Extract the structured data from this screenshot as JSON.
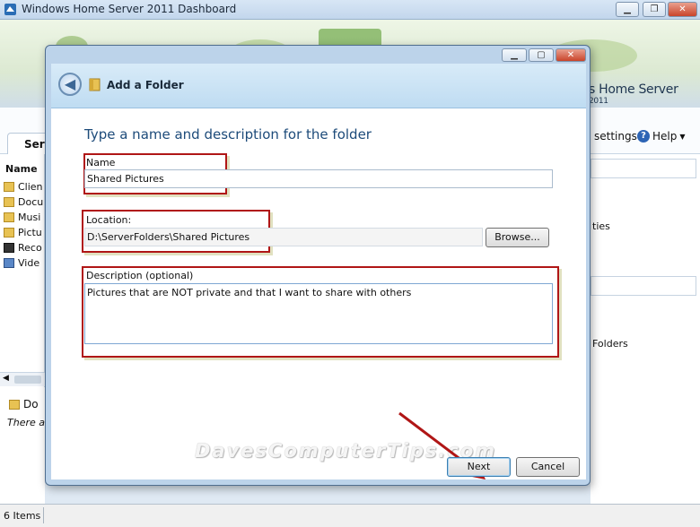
{
  "window": {
    "title": "Windows Home Server 2011 Dashboard",
    "brand": "Windows Home Server 2011",
    "brand_left": "s Home Server",
    "brand_year": "2011"
  },
  "nav": {
    "tab_label": "Serv",
    "settings_label": "settings",
    "help_label": "Help"
  },
  "folder_list": {
    "column_name": "Name",
    "items": [
      {
        "label": "Clien",
        "icon": "folder-icon"
      },
      {
        "label": "Docu",
        "icon": "folder-icon"
      },
      {
        "label": "Musi",
        "icon": "folder-icon"
      },
      {
        "label": "Pictu",
        "icon": "folder-icon"
      },
      {
        "label": "Reco",
        "icon": "recorded-tv-folder-icon"
      },
      {
        "label": "Vide",
        "icon": "videos-folder-icon"
      }
    ]
  },
  "details": {
    "title": "Do",
    "text": "There ar"
  },
  "right_panel": {
    "item1": "ties",
    "item2": "Folders"
  },
  "status": {
    "items_count": "6 Items"
  },
  "dialog": {
    "title": "Add a Folder",
    "heading": "Type a name and description for the folder",
    "name_label": "Name",
    "name_value": "Shared Pictures",
    "location_label": "Location:",
    "location_value": "D:\\ServerFolders\\Shared Pictures",
    "browse_label": "Browse...",
    "description_label": "Description (optional)",
    "description_value": "Pictures that are NOT private and that I want to share with others",
    "next_label": "Next",
    "cancel_label": "Cancel"
  },
  "watermark": "DavesComputerTips.com",
  "colors": {
    "annotation_red": "#b01616",
    "heading_blue": "#1d4b7a",
    "dialog_frame": "#bcd3ea"
  }
}
